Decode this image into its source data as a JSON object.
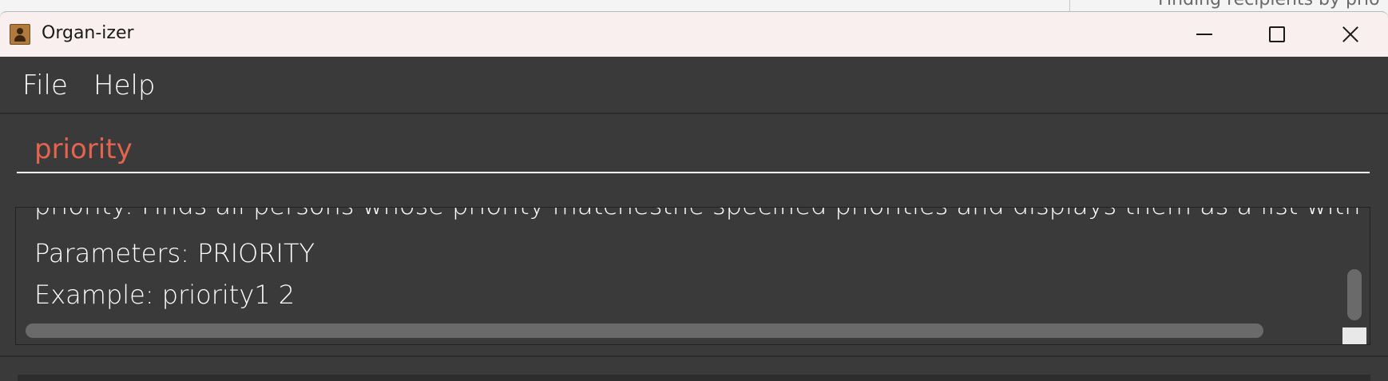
{
  "background_window": {
    "partial_text": "Finding recipients by prio"
  },
  "window": {
    "title": "Organ-izer",
    "icon": "address-book-icon",
    "controls": {
      "minimize_icon": "minimize-icon",
      "maximize_icon": "maximize-icon",
      "close_icon": "close-icon"
    }
  },
  "menu": {
    "items": [
      {
        "label": "File"
      },
      {
        "label": "Help"
      }
    ]
  },
  "command_box": {
    "value": "priority",
    "value_color": "#e4644f"
  },
  "result_display": {
    "lines": [
      "priority: Finds all persons whose priority matchesthe specified priorities and displays them as a list with index numb",
      "Parameters: PRIORITY",
      "Example: priority1 2"
    ]
  },
  "colors": {
    "window_bg": "#3a3a3a",
    "titlebar_bg": "#f9efee",
    "text": "#ffffff",
    "command_text": "#e4644f"
  }
}
